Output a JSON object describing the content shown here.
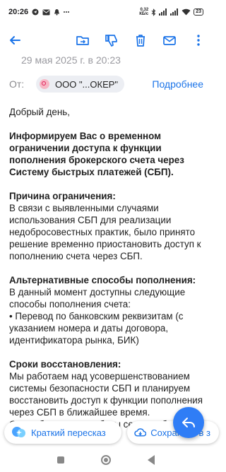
{
  "status_bar": {
    "time": "20:26",
    "net_speed_value": "0,32",
    "net_speed_unit": "КБ/с",
    "battery": "23"
  },
  "email": {
    "date": "29 мая 2025 г. в 20:23",
    "from_label": "От:",
    "sender": "ООО \"...ОКЕР\"",
    "details_link": "Подробнее",
    "greeting": "Добрый день, ",
    "intro": "Информируем Вас о временном ограничении доступа к функции пополнения брокерского счета через Систему быстрых платежей (СБП).",
    "reason_title": "Причина ограничения:",
    "reason_text": "В связи с выявленными случаями использования СБП для реализации недобросовестных практик, было принято решение временно приостановить доступ к пополнению счета через СБП.",
    "alt_title": "Альтернативные способы пополнения:",
    "alt_text": "В данный момент доступны следующие способы пополнения счета:",
    "alt_item": "• Перевод по банковским реквизитам (с указанием номера и даты договора, идентификатора рынка, БИК)",
    "terms_title": "Сроки восстановления:",
    "terms_text": "Мы работаем над усовершенствованием системы безопасности СБП и планируем восстановить доступ к функции пополнения через СБП в ближайшее время.",
    "terms_more": "О возобновлении работы сервиса бу"
  },
  "bottom": {
    "summary_label": "Краткий пересказ",
    "save_label": "Сохранить в з"
  }
}
